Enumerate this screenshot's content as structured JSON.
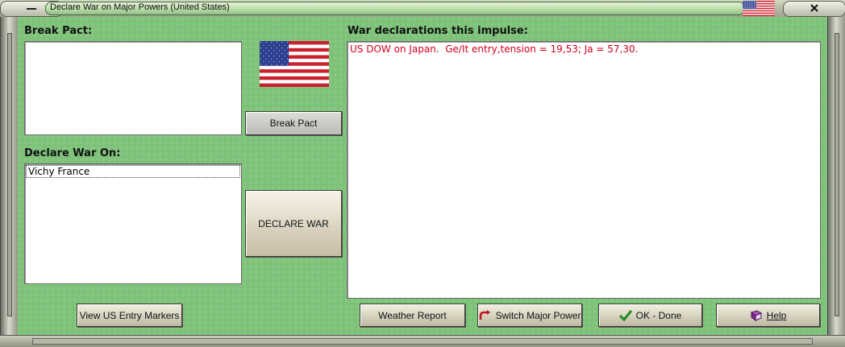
{
  "window": {
    "title": "Declare War on Major Powers (United States)"
  },
  "break_pact": {
    "heading": "Break Pact:",
    "items": [],
    "button_label": "Break Pact"
  },
  "declare_war": {
    "heading": "Declare War On:",
    "items": [
      "Vichy France"
    ],
    "button_label": "DECLARE WAR"
  },
  "declarations": {
    "heading": "War declarations this impulse:",
    "lines": [
      "US DOW on Japan.  Ge/It entry,tension = 19,53; Ja = 57,30."
    ]
  },
  "footer": {
    "view_entry_markers": "View US Entry Markers",
    "weather_report": "Weather Report",
    "switch_major_power": "Switch Major Power",
    "ok_done": "OK - Done",
    "help": "Help"
  },
  "flag": {
    "country": "United States",
    "stripe_red": "#cc1f2d",
    "canton_blue": "#2c3f8f"
  },
  "icons": {
    "minimize": "minimize-icon",
    "close": "close-icon",
    "switch": "switch-arrow-icon",
    "ok": "checkmark-icon",
    "help": "book-icon"
  }
}
